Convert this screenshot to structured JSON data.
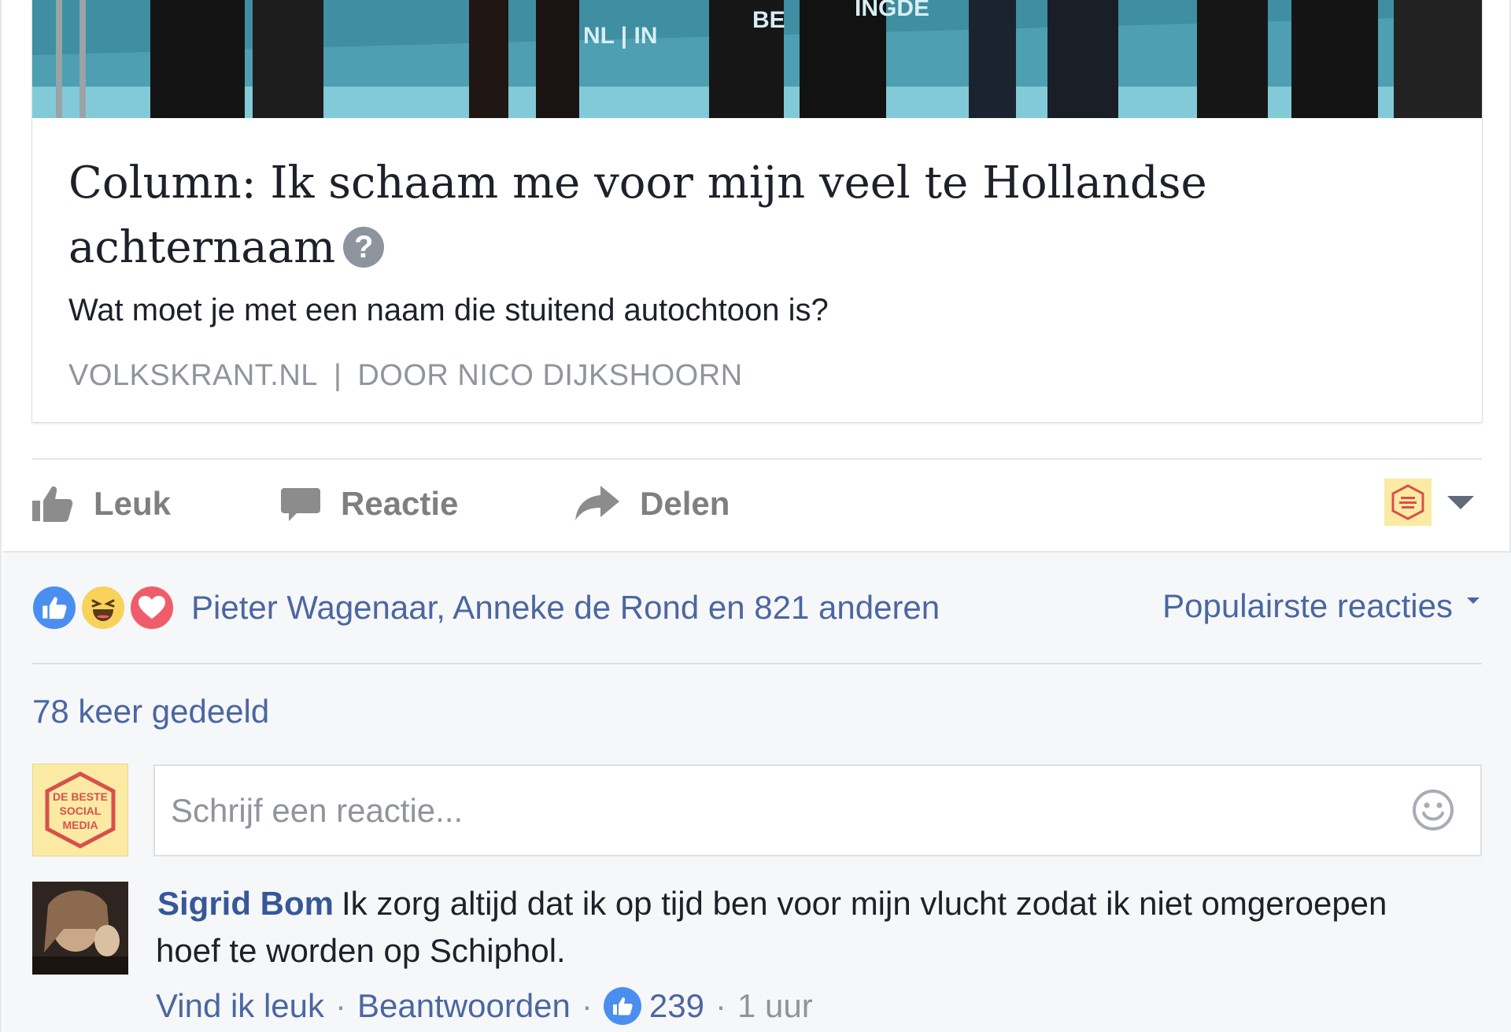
{
  "post": {
    "link_preview": {
      "title": "Column: Ik schaam me voor mijn veel te Hollandse achternaam",
      "description": "Wat moet je met een naam die stuitend autochtoon is?",
      "domain": "VOLKSKRANT.NL",
      "separator": "|",
      "author": "DOOR NICO DIJKSHOORN",
      "image_text": [
        "NL | IN",
        "BE",
        "INGDE"
      ]
    },
    "actions": {
      "like_label": "Leuk",
      "comment_label": "Reactie",
      "share_label": "Delen"
    }
  },
  "engagement": {
    "reaction_icons": [
      "like-icon",
      "haha-icon",
      "love-icon"
    ],
    "reactors_text": "Pieter Wagenaar, Anneke de Rond en 821 anderen",
    "sort_label": "Populairste reacties",
    "shares_text": "78 keer gedeeld"
  },
  "composer": {
    "avatar_text": [
      "DE BESTE",
      "SOCIAL",
      "MEDIA"
    ],
    "placeholder": "Schrijf een reactie..."
  },
  "comments": [
    {
      "author": "Sigrid Bom",
      "text": "Ik zorg altijd dat ik op tijd ben voor mijn vlucht zodat ik niet omgeroepen hoef te worden op Schiphol.",
      "like_action": "Vind ik leuk",
      "reply_action": "Beantwoorden",
      "like_count": "239",
      "time": "1 uur",
      "meta_separator": "·"
    }
  ],
  "colors": {
    "link_blue": "#4b67a1",
    "author_blue": "#365899",
    "muted_grey": "#90949c",
    "like_blue": "#4a8ff0",
    "love_red": "#ef5d6b",
    "haha_yellow": "#f8d25a",
    "page_avatar_bg": "#fbeaa4",
    "page_avatar_red": "#d8504a"
  }
}
